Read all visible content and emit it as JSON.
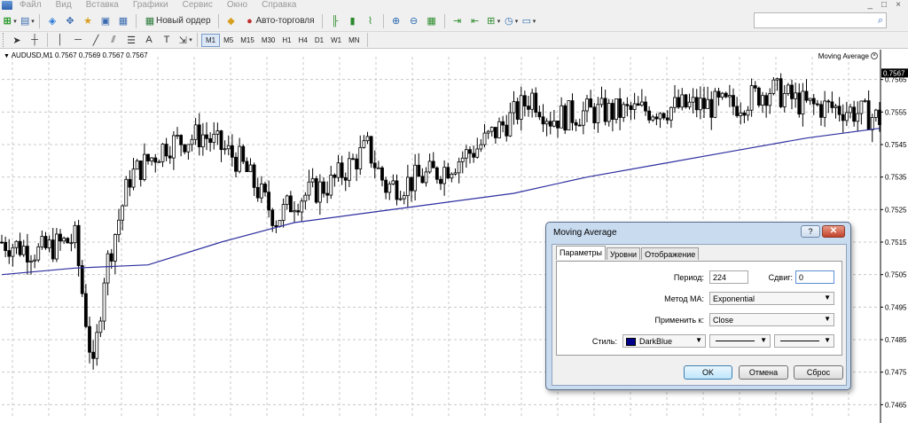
{
  "menu": {
    "items": [
      "Файл",
      "Вид",
      "Вставка",
      "Графики",
      "Сервис",
      "Окно",
      "Справка"
    ],
    "window_controls": [
      "_",
      "□",
      "×"
    ]
  },
  "toolbar": {
    "new_order_label": "Новый ордер",
    "autotrading_label": "Авто-торговля",
    "timeframes": [
      "M1",
      "M5",
      "M15",
      "M30",
      "H1",
      "H4",
      "D1",
      "W1",
      "MN"
    ],
    "active_timeframe": "M1",
    "drawing_tools": [
      "cursor-icon",
      "crosshair-icon",
      "vertical-line-icon",
      "horizontal-line-icon",
      "trendline-icon",
      "channel-icon",
      "fibonacci-icon",
      "text-icon",
      "label-icon",
      "shapes-icon"
    ],
    "text_tool_label": "A",
    "label_tool_label": "T"
  },
  "search": {
    "placeholder": ""
  },
  "chart": {
    "header": "AUDUSD,M1  0.7567 0.7569 0.7567 0.7567",
    "indicator_label": "Moving Average",
    "current_price": "0.7567",
    "price_ticks": [
      "0.7565",
      "0.7555",
      "0.7545",
      "0.7535",
      "0.7525",
      "0.7515",
      "0.7505",
      "0.7495",
      "0.7485",
      "0.7475",
      "0.7465"
    ],
    "ma_color": "#2e2ea0",
    "candle_color": "#000000",
    "grid_color": "#c8c8c8"
  },
  "chart_data": {
    "type": "line",
    "title": "AUDUSD,M1",
    "ylim": [
      0.7461,
      0.7572
    ],
    "y_ticks": [
      0.7565,
      0.7555,
      0.7545,
      0.7535,
      0.7525,
      0.7515,
      0.7505,
      0.7495,
      0.7485,
      0.7475,
      0.7465
    ],
    "series": [
      {
        "name": "Moving Average",
        "x": [
          0,
          20,
          40,
          60,
          80,
          100,
          120,
          140,
          160,
          180,
          200,
          220,
          240
        ],
        "values": [
          0.7505,
          0.7507,
          0.7508,
          0.7515,
          0.7521,
          0.7524,
          0.7527,
          0.753,
          0.7535,
          0.7539,
          0.7543,
          0.7547,
          0.755
        ]
      },
      {
        "name": "Close",
        "x": [
          0,
          10,
          20,
          25,
          28,
          35,
          45,
          55,
          65,
          75,
          80,
          90,
          100,
          105,
          110,
          120,
          130,
          140,
          145,
          150,
          160,
          170,
          180,
          190,
          200,
          210,
          220,
          230,
          240
        ],
        "values": [
          0.7515,
          0.7512,
          0.7516,
          0.7475,
          0.7505,
          0.7535,
          0.7545,
          0.7548,
          0.754,
          0.7522,
          0.7528,
          0.7533,
          0.7544,
          0.7532,
          0.7533,
          0.7537,
          0.7544,
          0.7554,
          0.756,
          0.7553,
          0.7555,
          0.7555,
          0.7556,
          0.7557,
          0.7557,
          0.7562,
          0.7557,
          0.7556,
          0.7553
        ]
      }
    ]
  },
  "dialog": {
    "title": "Moving Average",
    "help_label": "?",
    "close_label": "✕",
    "tabs": [
      "Параметры",
      "Уровни",
      "Отображение"
    ],
    "period_label": "Период:",
    "period_value": "224",
    "shift_label": "Сдвиг:",
    "shift_value": "0",
    "method_label": "Метод МА:",
    "method_value": "Exponential",
    "apply_label": "Применить к:",
    "apply_value": "Close",
    "style_label": "Стиль:",
    "style_color_name": "DarkBlue",
    "style_color": "#00008b",
    "ok_label": "OK",
    "cancel_label": "Отмена",
    "reset_label": "Сброс"
  }
}
